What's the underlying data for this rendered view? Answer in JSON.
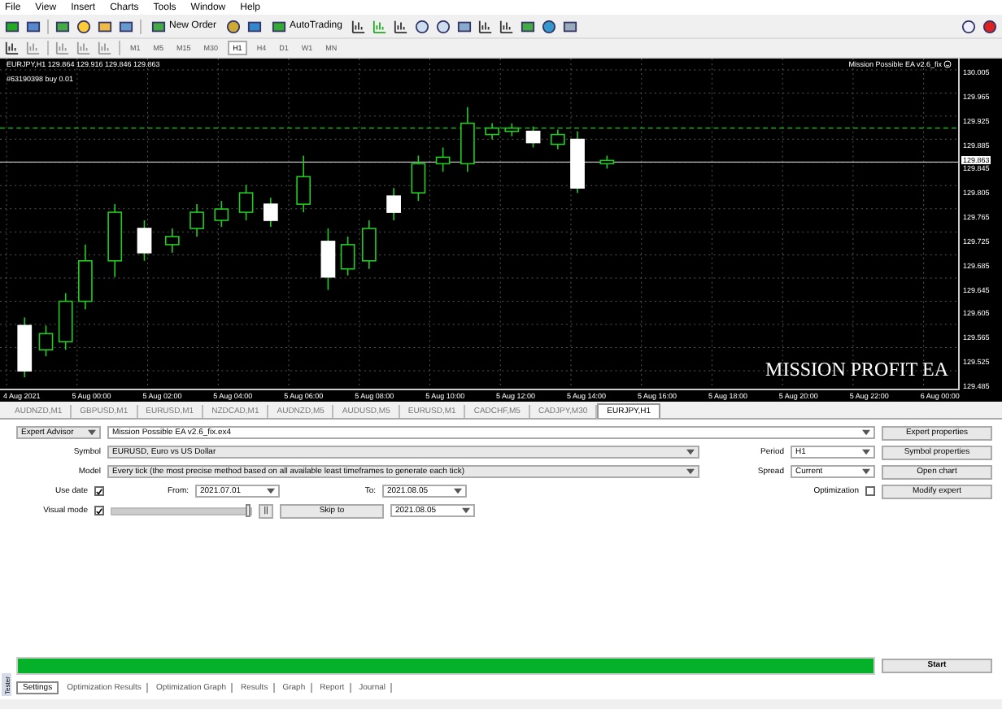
{
  "menu": [
    "File",
    "View",
    "Insert",
    "Charts",
    "Tools",
    "Window",
    "Help"
  ],
  "toolbar": {
    "new_order": "New Order",
    "autotrading": "AutoTrading",
    "timeframes": [
      {
        "label": "M1",
        "selected": false
      },
      {
        "label": "M5",
        "selected": false
      },
      {
        "label": "M15",
        "selected": false
      },
      {
        "label": "M30",
        "selected": false
      },
      {
        "label": "H1",
        "selected": true
      },
      {
        "label": "H4",
        "selected": false
      },
      {
        "label": "D1",
        "selected": false
      },
      {
        "label": "W1",
        "selected": false
      },
      {
        "label": "MN",
        "selected": false
      }
    ]
  },
  "chart": {
    "header": "EURJPY,H1  129.864 129.916 129.846 129.863",
    "expert_label": "Mission Possible EA v2.6_fix",
    "order_label": "#63190398 buy 0.01",
    "overlay_text": "MISSION PROFIT EA",
    "current_price": "129.863",
    "price_labels": [
      "130.005",
      "129.965",
      "129.925",
      "129.885",
      "129.845",
      "129.805",
      "129.765",
      "129.725",
      "129.685",
      "129.645",
      "129.605",
      "129.565",
      "129.525",
      "129.485"
    ],
    "time_labels": [
      "4 Aug 2021",
      "5 Aug 00:00",
      "5 Aug 02:00",
      "5 Aug 04:00",
      "5 Aug 06:00",
      "5 Aug 08:00",
      "5 Aug 10:00",
      "5 Aug 12:00",
      "5 Aug 14:00",
      "5 Aug 16:00",
      "5 Aug 18:00",
      "5 Aug 20:00",
      "5 Aug 22:00",
      "6 Aug 00:00"
    ]
  },
  "chart_tabs": [
    {
      "label": "AUDNZD,M1",
      "selected": false
    },
    {
      "label": "GBPUSD,M1",
      "selected": false
    },
    {
      "label": "EURUSD,M1",
      "selected": false
    },
    {
      "label": "NZDCAD,M1",
      "selected": false
    },
    {
      "label": "AUDNZD,M5",
      "selected": false
    },
    {
      "label": "AUDUSD,M5",
      "selected": false
    },
    {
      "label": "EURUSD,M1",
      "selected": false
    },
    {
      "label": "CADCHF,M5",
      "selected": false
    },
    {
      "label": "CADJPY,M30",
      "selected": false
    },
    {
      "label": "EURJPY,H1",
      "selected": true
    }
  ],
  "tester": {
    "type": "Expert Advisor",
    "expert": "Mission Possible EA v2.6_fix.ex4",
    "symbol_label": "Symbol",
    "symbol": "EURUSD, Euro vs US Dollar",
    "model_label": "Model",
    "model": "Every tick (the most precise method based on all available least timeframes to generate each tick)",
    "period_label": "Period",
    "period": "H1",
    "spread_label": "Spread",
    "spread": "Current",
    "use_date": {
      "label": "Use date",
      "checked": true
    },
    "from_label": "From:",
    "from": "2021.07.01",
    "to_label": "To:",
    "to": "2021.08.05",
    "optimization": {
      "label": "Optimization",
      "checked": false
    },
    "visual_mode": {
      "label": "Visual mode",
      "checked": true
    },
    "speed_slider": {
      "level": 1.0
    },
    "pause": "||",
    "skip_to": "Skip to",
    "skip_date": "2021.08.05",
    "buttons": [
      "Expert properties",
      "Symbol properties",
      "Open chart",
      "Modify expert"
    ],
    "progress": {
      "level": 1.0
    },
    "start": "Start"
  },
  "bottom_tabs": [
    {
      "label": "Settings",
      "selected": true
    },
    {
      "label": "Optimization Results",
      "selected": false
    },
    {
      "label": "Optimization Graph",
      "selected": false
    },
    {
      "label": "Results",
      "selected": false
    },
    {
      "label": "Graph",
      "selected": false
    },
    {
      "label": "Report",
      "selected": false
    },
    {
      "label": "Journal",
      "selected": false
    }
  ],
  "side_label": "Tester"
}
